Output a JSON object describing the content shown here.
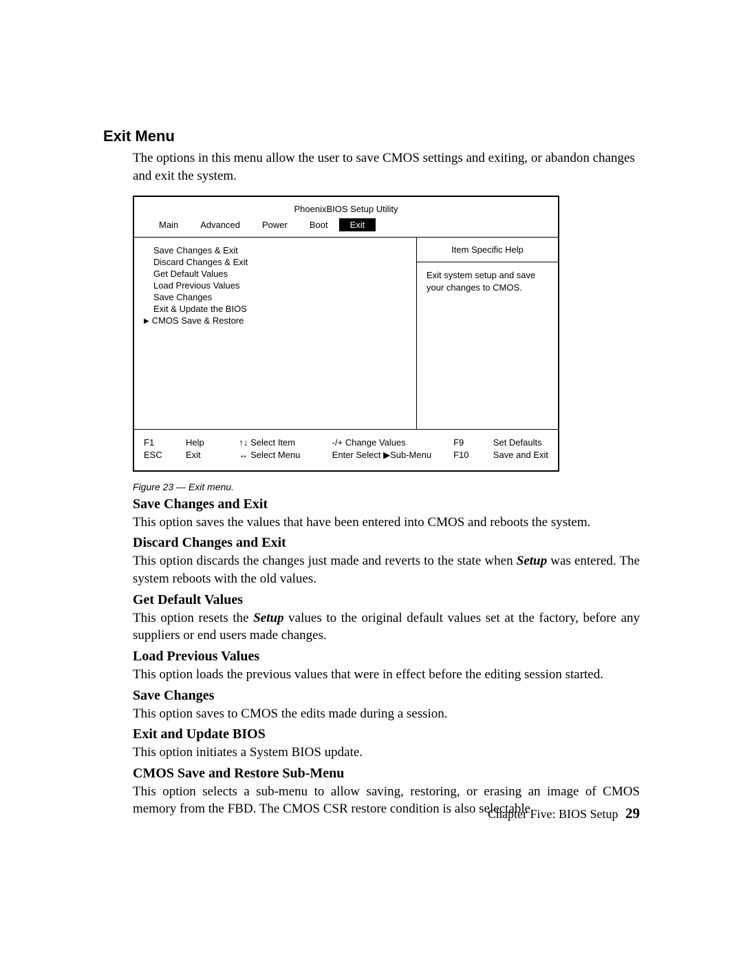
{
  "section_title": "Exit Menu",
  "intro": "The options in this menu allow the user to save CMOS settings and exiting, or abandon changes and exit the system.",
  "bios": {
    "title": "PhoenixBIOS Setup Utility",
    "tabs": [
      "Main",
      "Advanced",
      "Power",
      "Boot",
      "Exit"
    ],
    "selected_tab_index": 4,
    "menu_items": [
      {
        "label": "Save Changes & Exit",
        "submenu": false
      },
      {
        "label": "Discard Changes & Exit",
        "submenu": false
      },
      {
        "label": "Get Default Values",
        "submenu": false
      },
      {
        "label": "Load Previous Values",
        "submenu": false
      },
      {
        "label": "Save Changes",
        "submenu": false
      },
      {
        "label": "Exit & Update the BIOS",
        "submenu": false
      },
      {
        "label": "CMOS Save & Restore",
        "submenu": true
      }
    ],
    "help_title": "Item Specific Help",
    "help_body": "Exit system setup and save your changes to CMOS.",
    "footer": {
      "left_keys": [
        "F1",
        "ESC"
      ],
      "left_actions": [
        "Help",
        "Exit"
      ],
      "nav": [
        "↑↓ Select Item",
        "↔ Select Menu"
      ],
      "vals": [
        "-/+ Change Values",
        "Enter Select ▶Sub-Menu"
      ],
      "right_keys": [
        "F9",
        "F10"
      ],
      "right_actions": [
        "Set Defaults",
        "Save and Exit"
      ]
    }
  },
  "figure_caption": "Figure 23 — Exit menu.",
  "sections": [
    {
      "heading": "Save Changes and Exit",
      "body_pre": "This option saves the values that have been entered into CMOS and reboots the system.",
      "em1": "",
      "body_mid": "",
      "em2": "",
      "body_post": ""
    },
    {
      "heading": "Discard Changes and Exit",
      "body_pre": "This option discards the changes just made and reverts to the state when ",
      "em1": "Setup",
      "body_mid": " was entered. The system reboots with the old values.",
      "em2": "",
      "body_post": ""
    },
    {
      "heading": "Get Default Values",
      "body_pre": "This option resets the ",
      "em1": "Setup",
      "body_mid": " values to the original default values set at the factory, before any suppliers or end users made changes.",
      "em2": "",
      "body_post": ""
    },
    {
      "heading": "Load Previous Values",
      "body_pre": "This option loads the previous values that were in effect before the editing session started.",
      "em1": "",
      "body_mid": "",
      "em2": "",
      "body_post": ""
    },
    {
      "heading": "Save Changes",
      "body_pre": "This option saves to CMOS the edits made during a session.",
      "em1": "",
      "body_mid": "",
      "em2": "",
      "body_post": ""
    },
    {
      "heading": "Exit and Update BIOS",
      "body_pre": "This option initiates a System BIOS update.",
      "em1": "",
      "body_mid": "",
      "em2": "",
      "body_post": ""
    },
    {
      "heading": "CMOS Save and Restore Sub-Menu",
      "body_pre": "This option selects a sub-menu to allow saving, restoring, or erasing an image of CMOS memory from the FBD. The CMOS CSR restore condition is also selectable.",
      "em1": "",
      "body_mid": "",
      "em2": "",
      "body_post": ""
    }
  ],
  "footer_text": "Chapter Five:  BIOS Setup",
  "page_number": "29"
}
